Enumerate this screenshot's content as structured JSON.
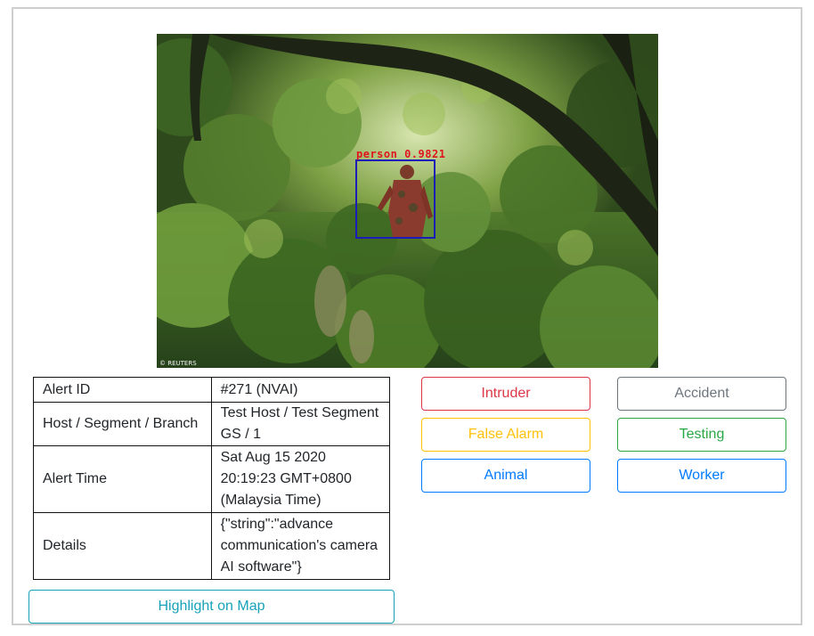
{
  "snapshot": {
    "detection_label": "person 0.9821",
    "watermark": "© REUTERS"
  },
  "alert_table": {
    "rows": [
      {
        "key": "Alert ID",
        "value_lines": [
          "#271 (NVAI)"
        ]
      },
      {
        "key": "Host / Segment / Branch",
        "value_lines": [
          "Test Host / Test Segment",
          "GS / 1"
        ]
      },
      {
        "key": "Alert Time",
        "value_lines": [
          "Sat Aug 15 2020",
          "20:19:23 GMT+0800",
          "(Malaysia Time)"
        ]
      },
      {
        "key": "Details",
        "value_lines": [
          "{\"string\":\"advance",
          "communication's camera",
          "AI software\"}"
        ]
      }
    ]
  },
  "actions": {
    "intruder": "Intruder",
    "accident": "Accident",
    "false_alarm": "False Alarm",
    "testing": "Testing",
    "animal": "Animal",
    "worker": "Worker"
  },
  "highlight_on_map": "Highlight on Map",
  "colors": {
    "danger": "#dc3545",
    "secondary": "#6c757d",
    "warning": "#ffc107",
    "success": "#28a745",
    "primary": "#007bff",
    "info": "#17a2b8",
    "detection_box": "#1c1cb8",
    "detection_text": "#e0161f"
  }
}
